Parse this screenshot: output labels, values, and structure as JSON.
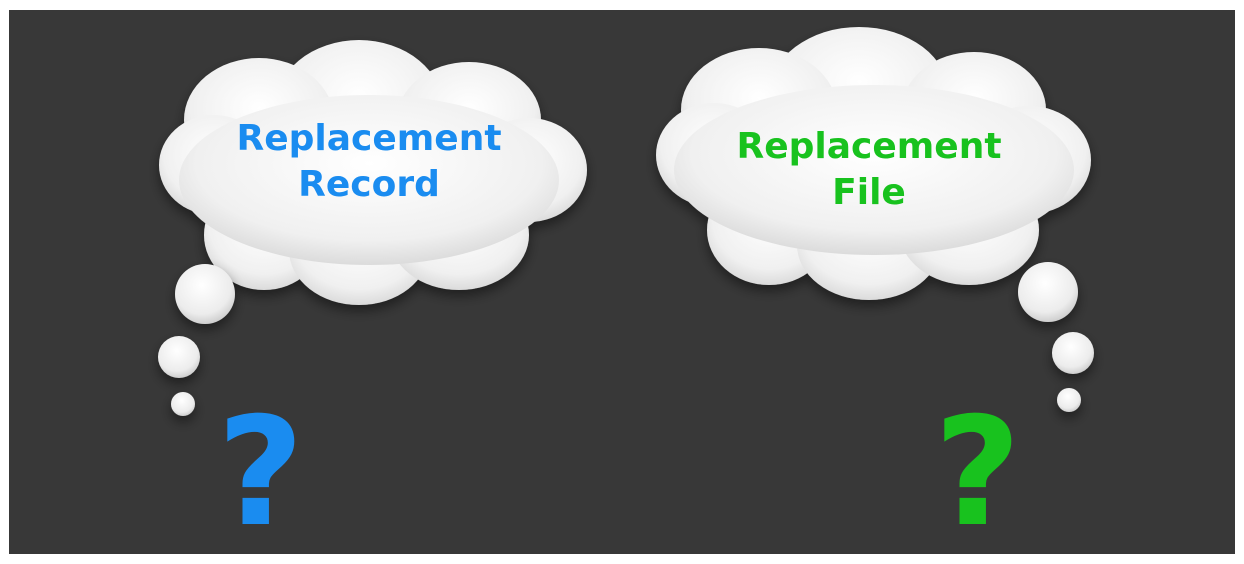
{
  "header": {
    "title": ""
  },
  "left_thought": {
    "line1": "Replacement",
    "line2": "Record",
    "question_mark": "?",
    "color": "#1a8cf0"
  },
  "right_thought": {
    "line1": "Replacement",
    "line2": "File",
    "question_mark": "?",
    "color": "#18c21e"
  },
  "colors": {
    "panel_background": "#383838",
    "cloud_fill": "#f2f2f2"
  },
  "icons": [
    "thought-cloud-icon",
    "thought-bubble-icon",
    "question-mark-icon"
  ]
}
